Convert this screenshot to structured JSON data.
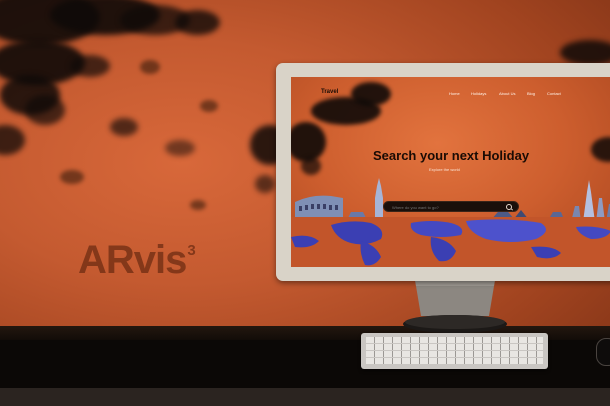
{
  "poster": {
    "brand_logo": "ARvis",
    "brand_logo_sup": "3"
  },
  "website": {
    "logo": "Travel",
    "nav": [
      "Home",
      "Holidays",
      "About Us",
      "Blog",
      "Contact"
    ],
    "hero_title": "Search your next Holiday",
    "hero_subtitle": "Explore the world",
    "search_placeholder": "Where do you want to go?"
  },
  "colors": {
    "background_orange": "#c45a30",
    "cloud_dark": "#0f0a08",
    "map_blue": "#3b3fb3",
    "monitor_frame": "#d9d3c8"
  },
  "icons": {
    "search": "search-icon"
  }
}
